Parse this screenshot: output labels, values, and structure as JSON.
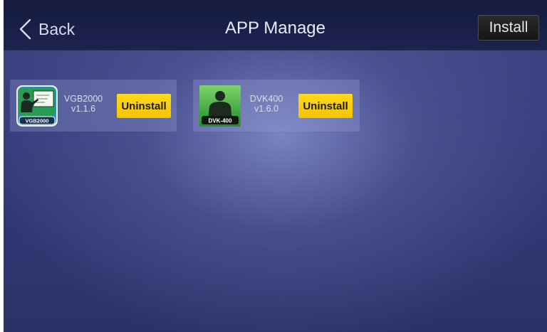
{
  "header": {
    "back_label": "Back",
    "title": "APP Manage",
    "install_label": "Install"
  },
  "apps": [
    {
      "name": "VGB2000",
      "version": "v1.1.6",
      "icon_label": "VGB2000",
      "icon": "vgb2000-app-icon",
      "uninstall_label": "Uninstall"
    },
    {
      "name": "DVK400",
      "version": "v1.6.0",
      "icon_label": "DVK-400",
      "icon": "dvk400-app-icon",
      "uninstall_label": "Uninstall"
    }
  ],
  "colors": {
    "header_bg": "#141b3d",
    "screen_bg": "#333a78",
    "uninstall_bg": "#ffd200",
    "install_bg": "#1f1f1f"
  }
}
